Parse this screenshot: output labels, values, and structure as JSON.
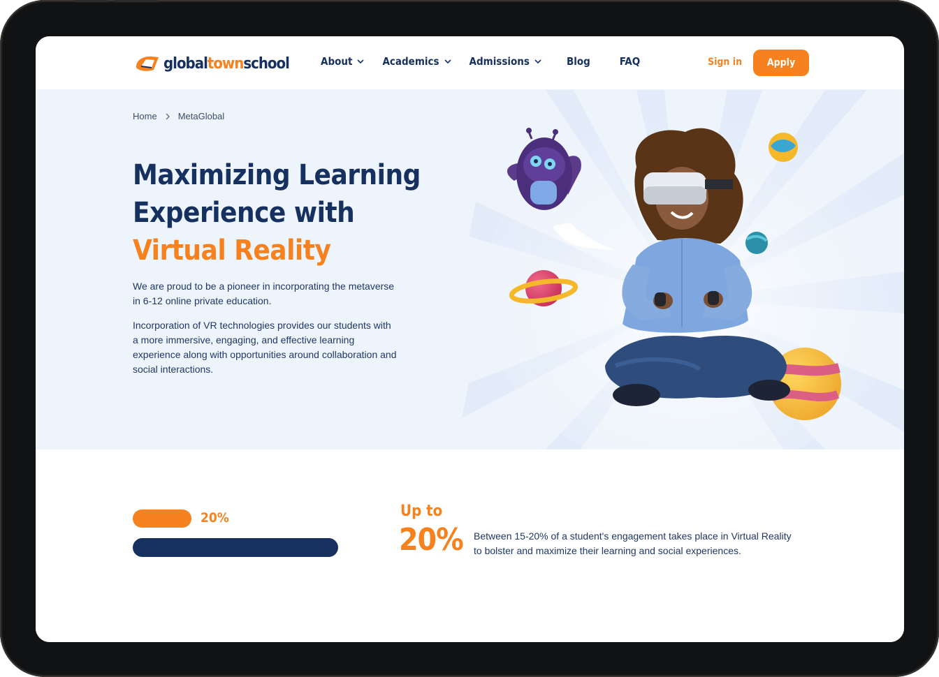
{
  "brand": {
    "logo_part1": "global",
    "logo_part2": "town",
    "logo_part3": "school",
    "accent_color": "#f5821f",
    "navy_color": "#16305f"
  },
  "nav": {
    "items": [
      {
        "label": "About",
        "has_dropdown": true
      },
      {
        "label": "Academics",
        "has_dropdown": true
      },
      {
        "label": "Admissions",
        "has_dropdown": true
      },
      {
        "label": "Blog",
        "has_dropdown": false
      },
      {
        "label": "FAQ",
        "has_dropdown": false
      }
    ],
    "signin_label": "Sign in",
    "apply_label": "Apply"
  },
  "breadcrumb": {
    "home": "Home",
    "current": "MetaGlobal"
  },
  "hero": {
    "title_line1": "Maximizing Learning",
    "title_line2": "Experience with",
    "title_line3": "Virtual Reality",
    "paragraph1": "We are proud to be a pioneer in incorporating the metaverse in 6-12 online private education.",
    "paragraph2": "Incorporation of VR technologies provides our students with a more immersive, engaging, and effective learning experience along with opportunities around collaboration and social interactions."
  },
  "stats": {
    "progress_percent": 20,
    "progress_label": "20%",
    "up_to_label": "Up to",
    "big_value": "20%",
    "description": "Between 15-20% of a student's engagement takes place in Virtual Reality to bolster and maximize their learning and social experiences."
  }
}
